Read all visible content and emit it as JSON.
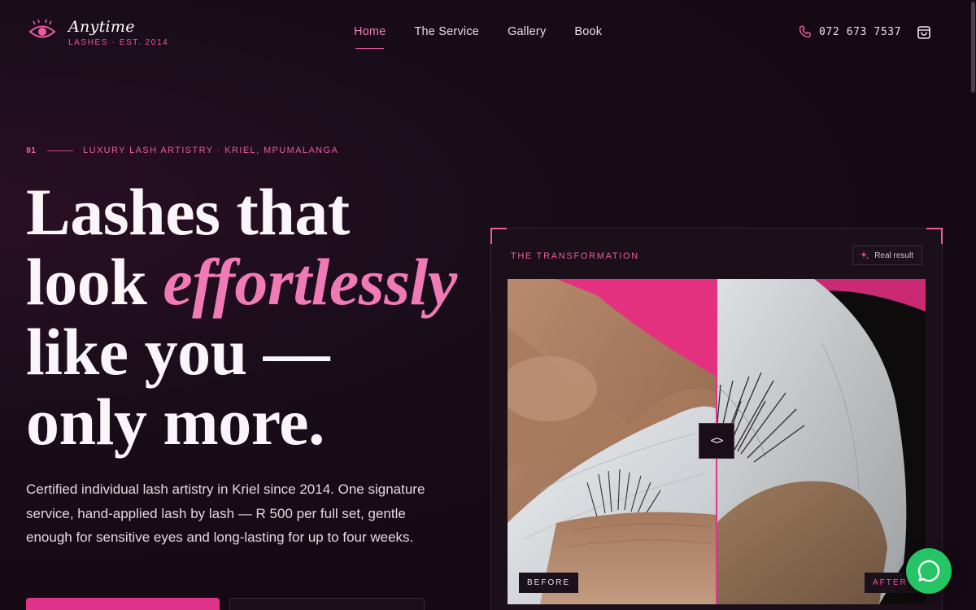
{
  "brand": {
    "name": "Anytime",
    "tagline": "LASHES · EST. 2014",
    "logo_icon": "eye-icon",
    "accent_color": "#ec5ba1"
  },
  "nav": {
    "items": [
      {
        "label": "Home",
        "active": true
      },
      {
        "label": "The Service",
        "active": false
      },
      {
        "label": "Gallery",
        "active": false
      },
      {
        "label": "Book",
        "active": false
      }
    ]
  },
  "contact": {
    "phone": "072 673 7537",
    "phone_icon": "phone-icon",
    "cart_icon": "shopping-bag-icon"
  },
  "hero": {
    "eyebrow_num": "01",
    "eyebrow_text": "LUXURY LASH ARTISTRY · KRIEL, MPUMALANGA",
    "headline_1": "Lashes that",
    "headline_2a": "look ",
    "headline_2b": "effortlessly",
    "headline_3": "like you —",
    "headline_4": "only more.",
    "lead": "Certified individual lash artistry in Kriel since 2014. One signature service, hand-applied lash by lash — R 500 per full set, gentle enough for sensitive eyes and long-lasting for up to four weeks."
  },
  "transformation": {
    "label": "THE TRANSFORMATION",
    "badge": "Real result",
    "badge_icon": "sparkle-icon",
    "before_label": "BEFORE",
    "after_label": "AFTER",
    "handle_glyph": "<>",
    "slider_position": 0.5
  },
  "whatsapp": {
    "icon": "whatsapp-icon",
    "color": "#25c464"
  }
}
